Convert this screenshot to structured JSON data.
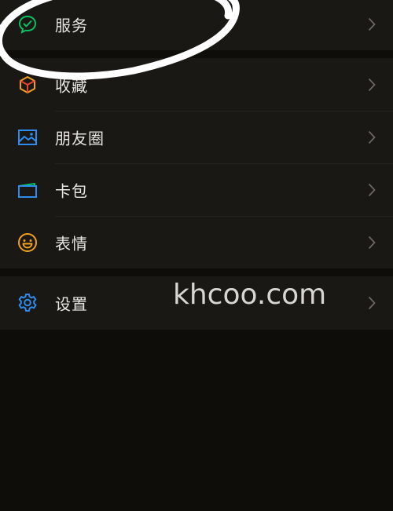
{
  "menu": {
    "groups": [
      {
        "items": [
          {
            "label": "服务",
            "icon": "services-icon",
            "icon_color": "#07c160"
          }
        ]
      },
      {
        "items": [
          {
            "label": "收藏",
            "icon": "favorites-cube-icon",
            "icon_color": "#f0a020"
          },
          {
            "label": "朋友圈",
            "icon": "moments-image-icon",
            "icon_color": "#2d8cf0"
          },
          {
            "label": "卡包",
            "icon": "card-wallet-icon",
            "icon_color": "#2d8cf0"
          },
          {
            "label": "表情",
            "icon": "smiley-icon",
            "icon_color": "#f0a020"
          }
        ]
      },
      {
        "items": [
          {
            "label": "设置",
            "icon": "settings-gear-icon",
            "icon_color": "#2d8cf0"
          }
        ]
      }
    ]
  },
  "watermark": "khcoo.com",
  "colors": {
    "background": "#0e0d0a",
    "row_background": "#1a1814",
    "text": "#e8e6e1",
    "chevron": "#6b6862",
    "annotation_stroke": "#ffffff"
  }
}
